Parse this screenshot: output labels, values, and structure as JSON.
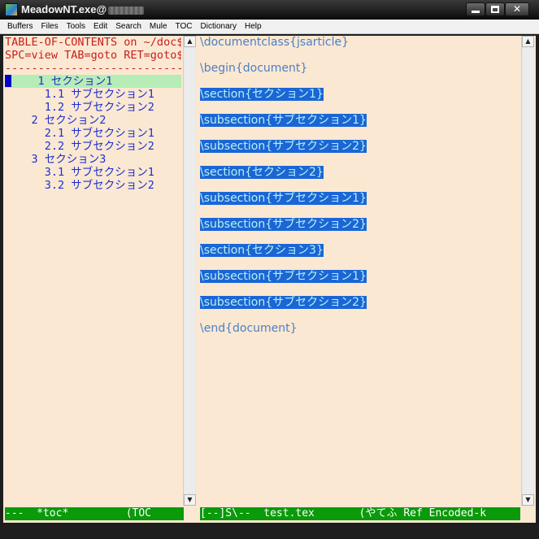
{
  "window": {
    "title": "MeadowNT.exe@",
    "minimize_icon": "minimize-icon",
    "maximize_icon": "maximize-icon",
    "close_label": "✕"
  },
  "menu": [
    "Buffers",
    "Files",
    "Tools",
    "Edit",
    "Search",
    "Mule",
    "TOC",
    "Dictionary",
    "Help"
  ],
  "toc_pane": {
    "header_lines": [
      "TABLE-OF-CONTENTS on ~/doc$",
      "SPC=view TAB=goto RET=goto$",
      "---------------------------$"
    ],
    "items": [
      "    1 セクション1",
      "      1.1 サブセクション1",
      "      1.2 サブセクション2",
      "    2 セクション2",
      "      2.1 サブセクション1",
      "      2.2 サブセクション2",
      "    3 セクション3",
      "      3.1 サブセクション1",
      "      3.2 サブセクション2"
    ],
    "current_index": 0
  },
  "tex_pane": {
    "lines": [
      {
        "text": "\\documentclass{jsarticle}",
        "highlight": false
      },
      {
        "text": "",
        "highlight": false
      },
      {
        "text": "\\begin{document}",
        "highlight": false
      },
      {
        "text": "",
        "highlight": false
      },
      {
        "text": "\\section{セクション1}",
        "highlight": true
      },
      {
        "text": "",
        "highlight": false
      },
      {
        "text": "\\subsection{サブセクション1}",
        "highlight": true
      },
      {
        "text": "",
        "highlight": false
      },
      {
        "text": "\\subsection{サブセクション2}",
        "highlight": true
      },
      {
        "text": "",
        "highlight": false
      },
      {
        "text": "\\section{セクション2}",
        "highlight": true
      },
      {
        "text": "",
        "highlight": false
      },
      {
        "text": "\\subsection{サブセクション1}",
        "highlight": true
      },
      {
        "text": "",
        "highlight": false
      },
      {
        "text": "\\subsection{サブセクション2}",
        "highlight": true
      },
      {
        "text": "",
        "highlight": false
      },
      {
        "text": "\\section{セクション3}",
        "highlight": true
      },
      {
        "text": "",
        "highlight": false
      },
      {
        "text": "\\subsection{サブセクション1}",
        "highlight": true
      },
      {
        "text": "",
        "highlight": false
      },
      {
        "text": "\\subsection{サブセクション2}",
        "highlight": true
      },
      {
        "text": "",
        "highlight": false
      },
      {
        "text": "\\end{document}",
        "highlight": false
      }
    ]
  },
  "modeline_left": "---  *toc*         (TOC",
  "modeline_right": "[--]S\\--  test.tex       (やてふ Ref Encoded-k",
  "scroll_up_icon": "▲",
  "scroll_down_icon": "▼",
  "colors": {
    "background": "#fbe8d2",
    "toc_header": "#c81e1e",
    "toc_item": "#1d2fcf",
    "toc_current_bg": "#b6ecb6",
    "tex_text": "#4a80c8",
    "highlight_bg": "#1b66d6",
    "modeline_bg": "#0a9a0a"
  }
}
